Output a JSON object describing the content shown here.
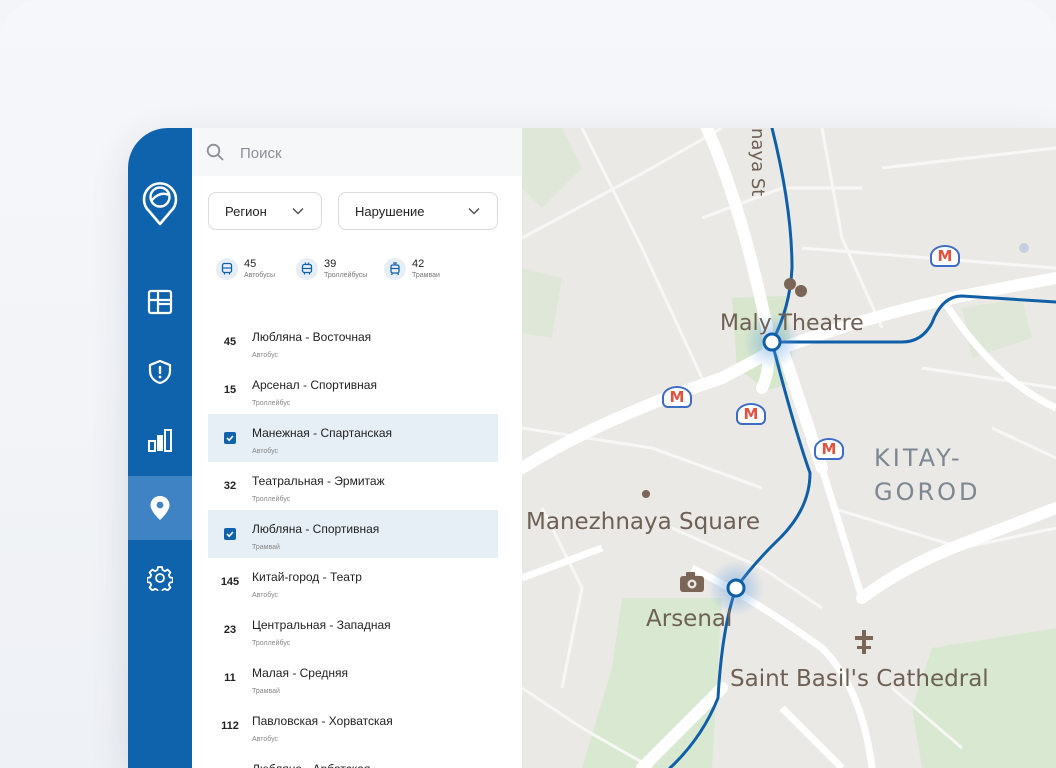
{
  "search": {
    "placeholder": "Поиск"
  },
  "filters": {
    "region": "Регион",
    "violation": "Нарушение"
  },
  "stats": [
    {
      "count": "45",
      "label": "Автобусы",
      "icon": "bus-icon"
    },
    {
      "count": "39",
      "label": "Троллейбусы",
      "icon": "trolleybus-icon"
    },
    {
      "count": "42",
      "label": "Трамваи",
      "icon": "tram-icon"
    }
  ],
  "routes": [
    {
      "number": "45",
      "name": "Любляна - Восточная",
      "type": "Автобус",
      "selected": false
    },
    {
      "number": "15",
      "name": "Арсенал - Спортивная",
      "type": "Троллейбус",
      "selected": false
    },
    {
      "number": "",
      "name": "Манежная - Спартанская",
      "type": "Автобус",
      "selected": true
    },
    {
      "number": "32",
      "name": "Театральная - Эрмитаж",
      "type": "Троллейбус",
      "selected": false
    },
    {
      "number": "",
      "name": "Любляна - Спортивная",
      "type": "Трамвай",
      "selected": true
    },
    {
      "number": "145",
      "name": "Китай-город - Театр",
      "type": "Автобус",
      "selected": false
    },
    {
      "number": "23",
      "name": "Центральная - Западная",
      "type": "Троллейбус",
      "selected": false
    },
    {
      "number": "11",
      "name": "Малая - Средняя",
      "type": "Трамвай",
      "selected": false
    },
    {
      "number": "112",
      "name": "Павловская - Хорватская",
      "type": "Автобус",
      "selected": false
    },
    {
      "number": "",
      "name": "Любляна - Арбатская",
      "type": "",
      "selected": false
    }
  ],
  "map": {
    "street": "naya St",
    "malyTheatre": "Maly Theatre",
    "kitayGorod": "KITAY-\nGOROD",
    "manezhnaya": "Manezhnaya Square",
    "arsenal": "Arsenal",
    "saintBasil": "Saint Basil's Cathedral",
    "metroLetter": "M"
  },
  "colors": {
    "sidebar": "#0f63ad",
    "sidebarActive": "#3f83c4",
    "routeLine": "#0f5fa8",
    "metro": "#e0533e"
  }
}
